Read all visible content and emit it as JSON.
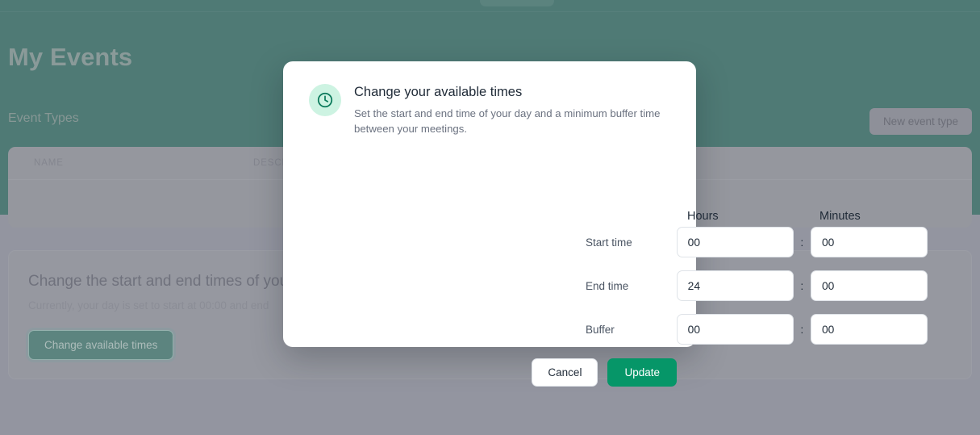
{
  "background": {
    "page_title": "My Events",
    "section_label": "Event Types",
    "new_event_button": "New event type",
    "table": {
      "columns": [
        "NAME",
        "DESCRIPTION"
      ]
    },
    "availability": {
      "title": "Change the start and end times of your",
      "subtitle": "Currently, your day is set to start at 00:00 and end",
      "button": "Change available times"
    }
  },
  "modal": {
    "icon": "clock-icon",
    "title": "Change your available times",
    "description": "Set the start and end time of your day and a minimum buffer time between your meetings.",
    "column_headers": {
      "hours": "Hours",
      "minutes": "Minutes"
    },
    "separator": ":",
    "rows": [
      {
        "label": "Start time",
        "hours": "00",
        "minutes": "00"
      },
      {
        "label": "End time",
        "hours": "24",
        "minutes": "00"
      },
      {
        "label": "Buffer",
        "hours": "00",
        "minutes": "00"
      }
    ],
    "actions": {
      "cancel": "Cancel",
      "update": "Update"
    }
  },
  "colors": {
    "header_teal": "#4f7a75",
    "dim_overlay": "#9395a0",
    "accent_green": "#069668",
    "icon_badge": "#cdf3e2"
  }
}
